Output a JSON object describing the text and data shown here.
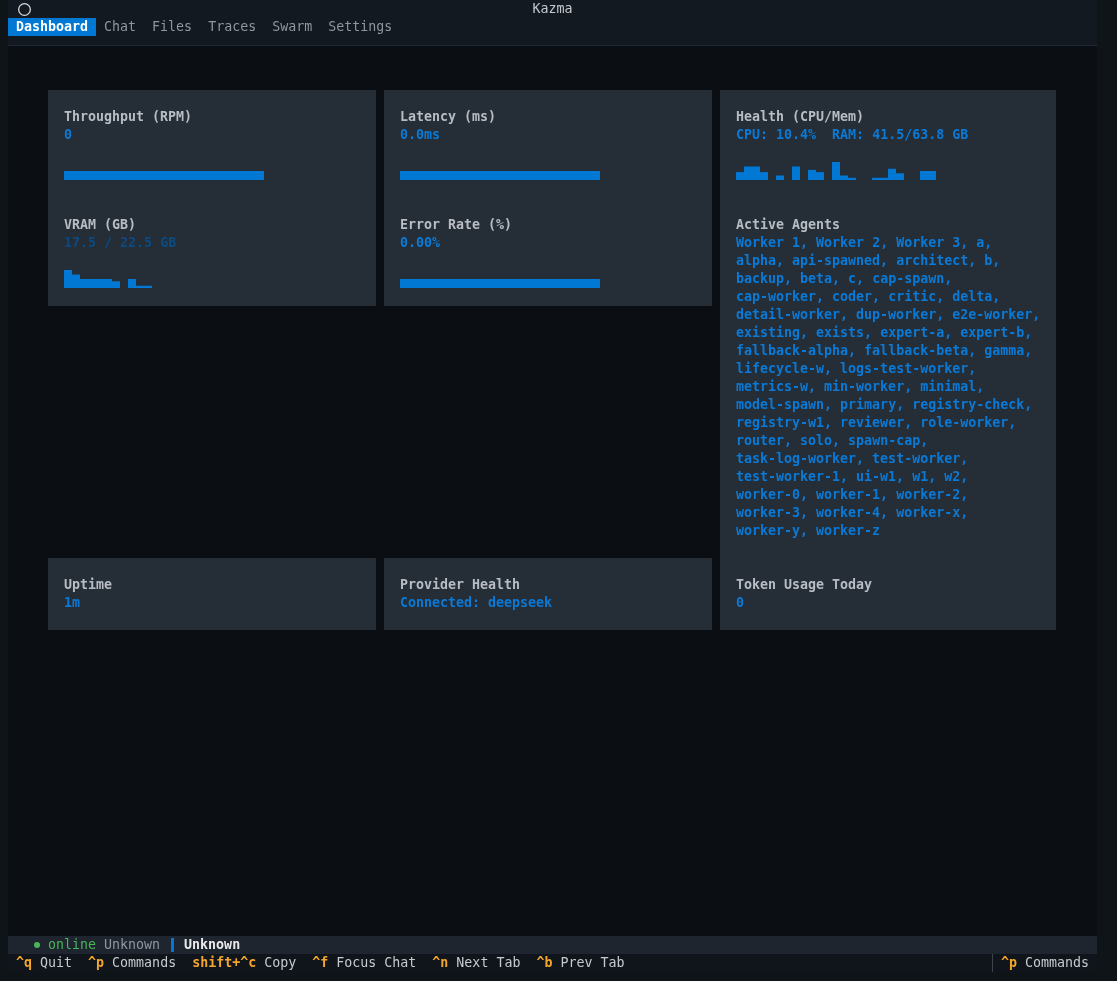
{
  "window": {
    "title": "Kazma"
  },
  "tabs": [
    {
      "label": "Dashboard",
      "selected": true
    },
    {
      "label": "Chat",
      "selected": false
    },
    {
      "label": "Files",
      "selected": false
    },
    {
      "label": "Traces",
      "selected": false
    },
    {
      "label": "Swarm",
      "selected": false
    },
    {
      "label": "Settings",
      "selected": false
    }
  ],
  "dashboard": {
    "columns": [
      {
        "kind": "split",
        "top": [
          {
            "label": "Throughput (RPM)",
            "value": "0",
            "kind": "flat_sparkline",
            "dimmed": false
          },
          {
            "label": "VRAM (GB)",
            "value": "17.5 / 22.5 GB",
            "kind": "sparkline",
            "dimmed": true
          }
        ],
        "bottom": [
          {
            "label": "Uptime",
            "value": "1m",
            "kind": "text",
            "dimmed": false
          }
        ]
      },
      {
        "kind": "split",
        "top": [
          {
            "label": "Latency (ms)",
            "value": "0.0ms",
            "kind": "flat_sparkline",
            "dimmed": false
          },
          {
            "label": "Error Rate (%)",
            "value": "0.00%",
            "kind": "flat_sparkline",
            "dimmed": false
          }
        ],
        "bottom": [
          {
            "label": "Provider Health",
            "value": "Connected: deepseek",
            "kind": "text",
            "dimmed": false
          }
        ]
      },
      {
        "kind": "tall",
        "top": [
          {
            "label": "Health (CPU/Mem)",
            "value": "CPU: 10.4%  RAM: 41.5/63.8 GB",
            "kind": "sparkline",
            "dimmed": false
          },
          {
            "label": "Active Agents",
            "value": "Worker 1, Worker 2, Worker 3, a, alpha, api-spawned, architect, b, backup, beta, c, cap-spawn, cap-worker, coder, critic, delta, detail-worker, dup-worker, e2e-worker, existing, exists, expert-a, expert-b, fallback-alpha, fallback-beta, gamma, lifecycle-w, logs-test-worker, metrics-w, min-worker, minimal, model-spawn, primary, registry-check, registry-w1, reviewer, role-worker, router, solo, spawn-cap, task-log-worker, test-worker, test-worker-1, ui-w1, w1, w2, worker-0, worker-1, worker-2, worker-3, worker-4, worker-x, worker-y, worker-z",
            "kind": "text",
            "dimmed": false
          }
        ],
        "bottom": [
          {
            "label": "Token Usage Today",
            "value": "0",
            "kind": "text",
            "dimmed": false
          }
        ]
      }
    ]
  },
  "status_bar": {
    "status": "online",
    "secondary": "Unknown",
    "primary": "Unknown"
  },
  "footer": {
    "bindings": [
      {
        "key": "^q",
        "label": "Quit"
      },
      {
        "key": "^p",
        "label": "Commands"
      },
      {
        "key": "shift+^c",
        "label": "Copy"
      },
      {
        "key": "^f",
        "label": "Focus Chat"
      },
      {
        "key": "^n",
        "label": "Next Tab"
      },
      {
        "key": "^b",
        "label": "Prev Tab"
      }
    ],
    "right_bindings": [
      {
        "key": "^p",
        "label": "Commands"
      }
    ]
  }
}
